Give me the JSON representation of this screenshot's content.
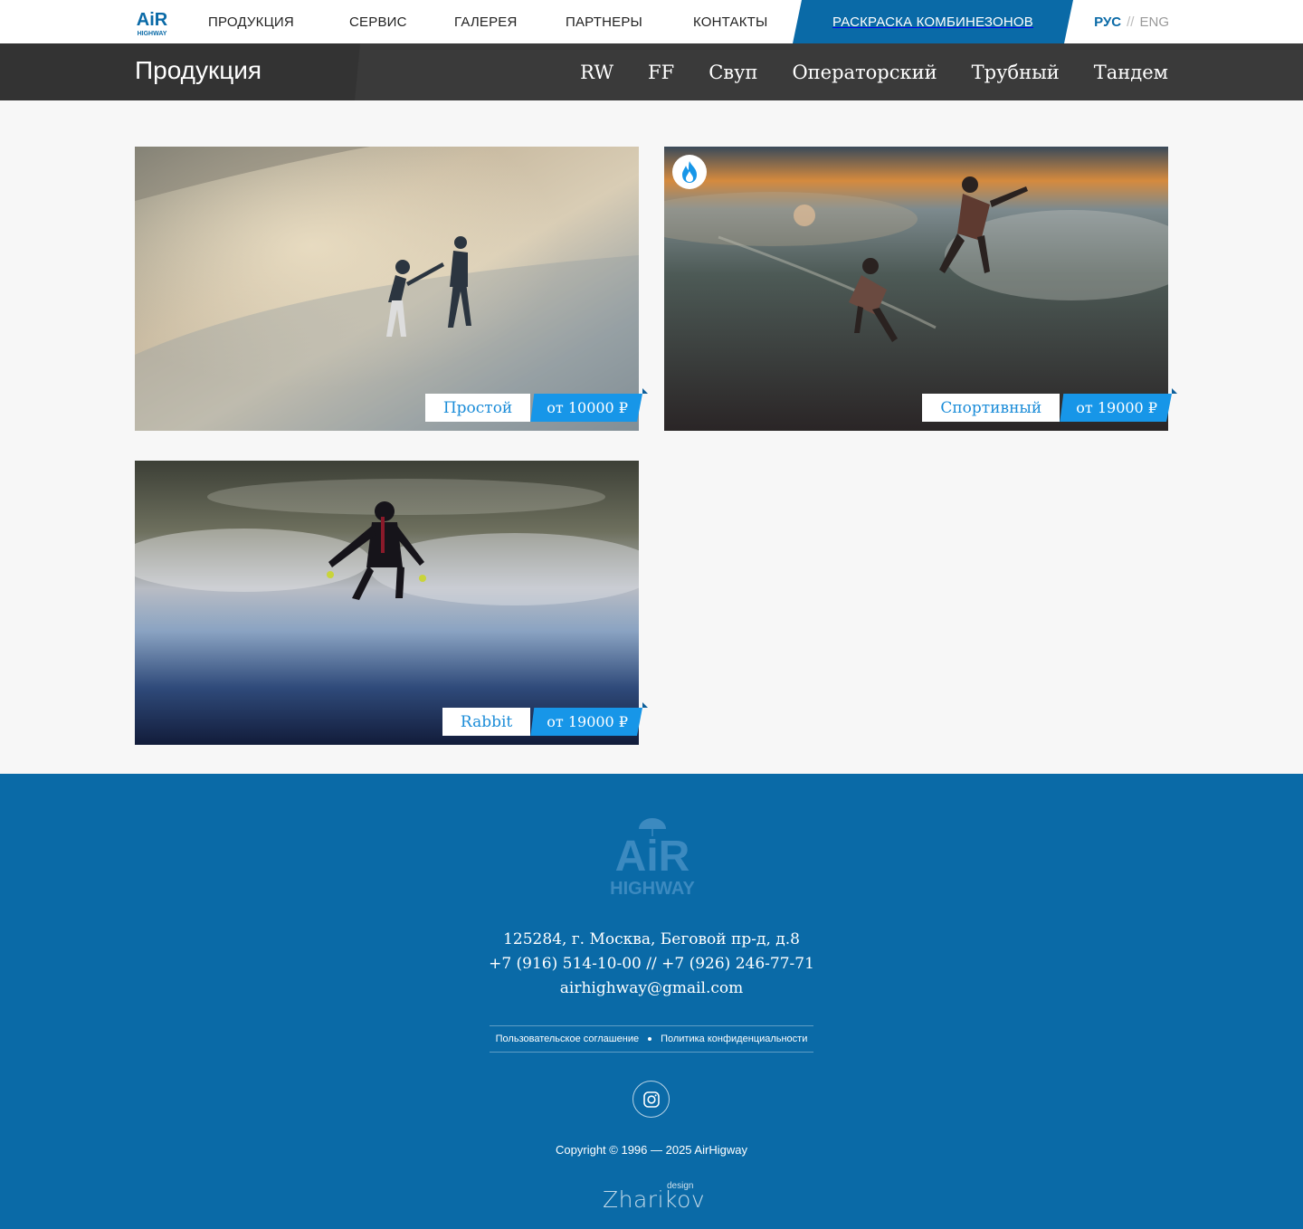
{
  "header": {
    "logo_text_top": "AiR",
    "logo_text_bottom": "HIGHWAY",
    "nav": [
      {
        "label": "ПРОДУКЦИЯ"
      },
      {
        "label": "СЕРВИС"
      },
      {
        "label": "ГАЛЕРЕЯ"
      },
      {
        "label": "ПАРТНЕРЫ"
      },
      {
        "label": "КОНТАКТЫ"
      }
    ],
    "promo": "РАСКРАСКА КОМБИНЕЗОНОВ",
    "lang_active": "РУС",
    "lang_sep": "//",
    "lang_other": "ENG"
  },
  "subheader": {
    "title": "Продукция",
    "tabs": [
      {
        "label": "RW"
      },
      {
        "label": "FF",
        "active": true
      },
      {
        "label": "Свуп"
      },
      {
        "label": "Операторский"
      },
      {
        "label": "Трубный"
      },
      {
        "label": "Тандем"
      }
    ]
  },
  "products": [
    {
      "name": "Простой",
      "price": "от 10000 ₽",
      "icon": "photo-two-skydivers"
    },
    {
      "name": "Спортивный",
      "price": "от 19000 ₽",
      "badge": "flame-icon",
      "icon": "photo-sunset-skydivers"
    },
    {
      "name": "Rabbit",
      "price": "от 19000 ₽",
      "icon": "photo-solo-skydiver"
    }
  ],
  "footer": {
    "logo_top": "AiR",
    "logo_bottom": "HIGHWAY",
    "address": "125284, г. Москва, Беговой пр-д, д.8",
    "phones": "+7 (916) 514-10-00 // +7 (926) 246-77-71",
    "email": "airhighway@gmail.com",
    "link_terms": "Пользовательское соглашение",
    "link_privacy": "Политика конфиденциальности",
    "social": "instagram-icon",
    "copyright": "Copyright © 1996 — 2025 AirHigway",
    "designer": "Zharikov",
    "designer_sup": "design"
  },
  "colors": {
    "brand_blue": "#0a6aa7",
    "accent_blue": "#1796e8",
    "dark_bar": "#3a3a3a"
  }
}
